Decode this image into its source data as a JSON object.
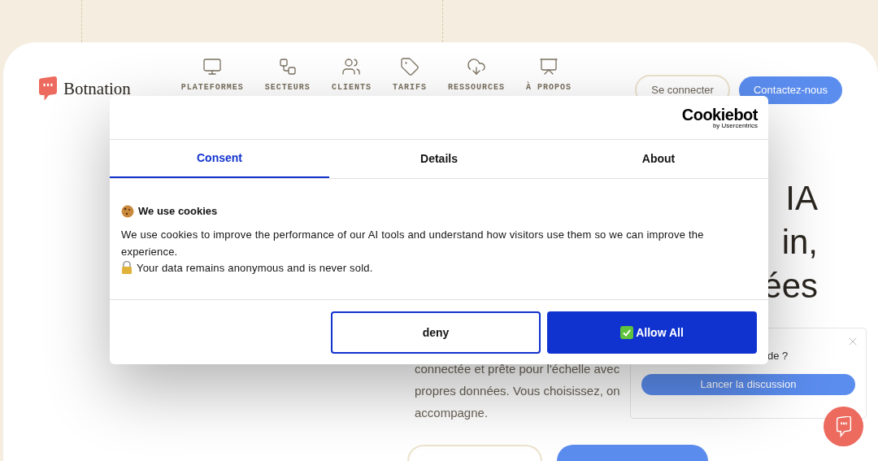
{
  "header": {
    "brand": "Botnation",
    "nav": [
      {
        "label": "PLATEFORMES"
      },
      {
        "label": "SECTEURS"
      },
      {
        "label": "CLIENTS"
      },
      {
        "label": "TARIFS"
      },
      {
        "label": "RESSOURCES"
      },
      {
        "label": "À PROPOS"
      }
    ],
    "login": "Se connecter",
    "contact": "Contactez-nous"
  },
  "hero": {
    "heading_lines": [
      "IA",
      "in,",
      "ées"
    ],
    "paragraph_lines": [
      "connectée et prête pour l'échelle avec",
      "propres données. Vous choisissez, on",
      "accompagne."
    ]
  },
  "cookie_dialog": {
    "logo": "Cookiebot",
    "logo_sub": "by Usercentrics",
    "tabs": [
      {
        "label": "Consent",
        "selected": true
      },
      {
        "label": "Details",
        "selected": false
      },
      {
        "label": "About",
        "selected": false
      }
    ],
    "title": "We use cookies",
    "text": "We use cookies to improve the performance of our AI tools and understand how visitors use them so we can improve the experience.",
    "note": "Your data remains anonymous and is never sold.",
    "deny": "deny",
    "allow": "Allow All"
  },
  "chat_popup": {
    "question": "de ?",
    "button": "Lancer la discussion"
  }
}
